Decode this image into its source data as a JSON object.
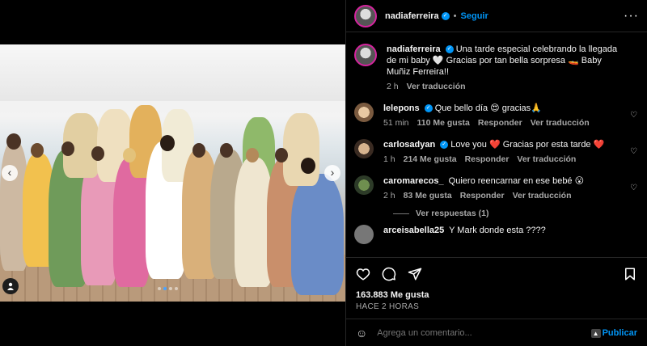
{
  "post": {
    "username": "nadiaferreira",
    "follow_label": "Seguir",
    "separator": "•",
    "more_label": "···"
  },
  "caption": {
    "username": "nadiaferreira",
    "text": "Una tarde especial celebrando la llegada de mi baby 🤍 Gracias por tan bella sorpresa 🚤 Baby Muñiz Ferreira!!",
    "age": "2 h",
    "translate": "Ver traducción"
  },
  "comments": [
    {
      "username": "lelepons",
      "verified": true,
      "text": "Que bello día 😍 gracias🙏",
      "age": "51 min",
      "likes": "110 Me gusta",
      "reply": "Responder",
      "translate": "Ver traducción"
    },
    {
      "username": "carlosadyan",
      "verified": true,
      "text": "Love you ❤️ Gracias por esta tarde ❤️",
      "age": "1 h",
      "likes": "214 Me gusta",
      "reply": "Responder",
      "translate": "Ver traducción"
    },
    {
      "username": "caromarecos_",
      "verified": false,
      "text": "Quiero reencarnar en ese bebé 😮",
      "age": "2 h",
      "likes": "83 Me gusta",
      "reply": "Responder",
      "translate": "Ver traducción"
    }
  ],
  "view_replies": "Ver respuestas (1)",
  "partial_comment": {
    "username": "arceisabella25",
    "text": "Y Mark donde esta ????"
  },
  "stats": {
    "likes": "163.883 Me gusta",
    "time": "HACE 2 HORAS"
  },
  "composer": {
    "placeholder": "Agrega un comentario...",
    "publish": "Publicar"
  },
  "carousel": {
    "slides": 4,
    "active_index": 1
  },
  "colors": {
    "accent": "#0095f6",
    "heart_red": "#ff3040",
    "background": "#000000"
  }
}
